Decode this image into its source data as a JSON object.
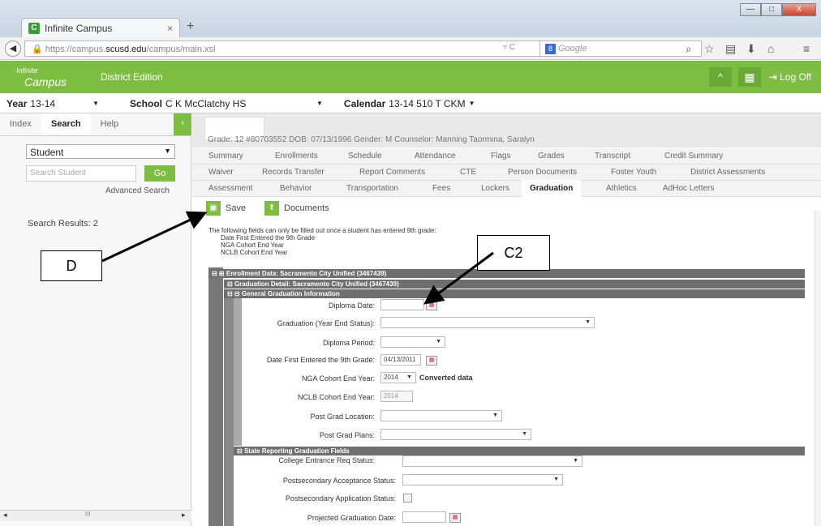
{
  "browser": {
    "tab_title": "Infinite Campus",
    "tab_close": "×",
    "new_tab": "+",
    "url_prefix": "https://campus.",
    "url_domain": "scusd.edu",
    "url_path": "/campus/main.xsl",
    "url_controls": "▿ C",
    "search_placeholder": "Google",
    "win_min": "—",
    "win_max": "□",
    "win_close": "X"
  },
  "app": {
    "logo_line1": "Infinite",
    "logo_line2": "Campus",
    "edition": "District Edition",
    "logoff": "⇥ Log Off",
    "collapse": "^",
    "grid": "▦"
  },
  "context": {
    "year_label": "Year",
    "year_value": "13-14",
    "school_label": "School",
    "school_value": "C K McClatchy HS",
    "calendar_label": "Calendar",
    "calendar_value": "13-14 510 T CKM"
  },
  "sidebar": {
    "tabs": [
      "Index",
      "Search",
      "Help"
    ],
    "collapse": "‹",
    "search_type": "Student",
    "search_placeholder": "Search Student",
    "go": "Go",
    "advanced": "Advanced Search",
    "results": "Search Results: 2",
    "scroll_mark": "III"
  },
  "student": {
    "demographics": "Grade: 12   #80703552   DOB: 07/13/1996   Gender: M   Counselor: Manning Taormina, Saralyn"
  },
  "tabs_row1": [
    "Summary",
    "Enrollments",
    "Schedule",
    "Attendance",
    "Flags",
    "Grades",
    "Transcript",
    "Credit Summary"
  ],
  "tabs_row2": [
    "Waiver",
    "Records Transfer",
    "Report Comments",
    "CTE",
    "Person Documents",
    "Foster Youth",
    "District Assessments"
  ],
  "tabs_row3": [
    "Assessment",
    "Behavior",
    "Transportation",
    "Fees",
    "Lockers",
    "Graduation",
    "Athletics",
    "AdHoc Letters"
  ],
  "actions": {
    "save": "Save",
    "documents": "Documents"
  },
  "intro": {
    "line1": "The following fields can only be filled out once a student has entered 9th grade:",
    "line2": "Date First Entered the 9th Grade",
    "line3": "NGA Cohort End Year",
    "line4": "NCLB Cohort End Year"
  },
  "sections": {
    "enrollment": "Enrollment Data: Sacramento City Unified (3467439)",
    "graduation_detail": "Graduation Detail: Sacramento City Unified (3467439)",
    "general": "General Graduation Information",
    "state": "State Reporting Graduation Fields"
  },
  "form": {
    "diploma_date": {
      "label": "Diploma Date:",
      "value": ""
    },
    "graduation_status": {
      "label": "Graduation (Year End Status):",
      "value": ""
    },
    "diploma_period": {
      "label": "Diploma Period:",
      "value": ""
    },
    "date_first_9th": {
      "label": "Date First Entered the 9th Grade:",
      "value": "04/13/2011"
    },
    "nga_cohort": {
      "label": "NGA Cohort End Year:",
      "value": "2014",
      "note": "Converted data"
    },
    "nclb_cohort": {
      "label": "NCLB Cohort End Year:",
      "value": "2014"
    },
    "post_grad_location": {
      "label": "Post Grad Location:",
      "value": ""
    },
    "post_grad_plans": {
      "label": "Post Grad Plans:",
      "value": ""
    },
    "college_entrance": {
      "label": "College Entrance Req Status:",
      "value": ""
    },
    "postsec_acceptance": {
      "label": "Postsecondary Acceptance Status:",
      "value": ""
    },
    "postsec_application": {
      "label": "Postsecondary Application Status:"
    },
    "projected_grad": {
      "label": "Projected Graduation Date:",
      "value": ""
    }
  },
  "callouts": {
    "d": "D",
    "c2": "C2"
  }
}
